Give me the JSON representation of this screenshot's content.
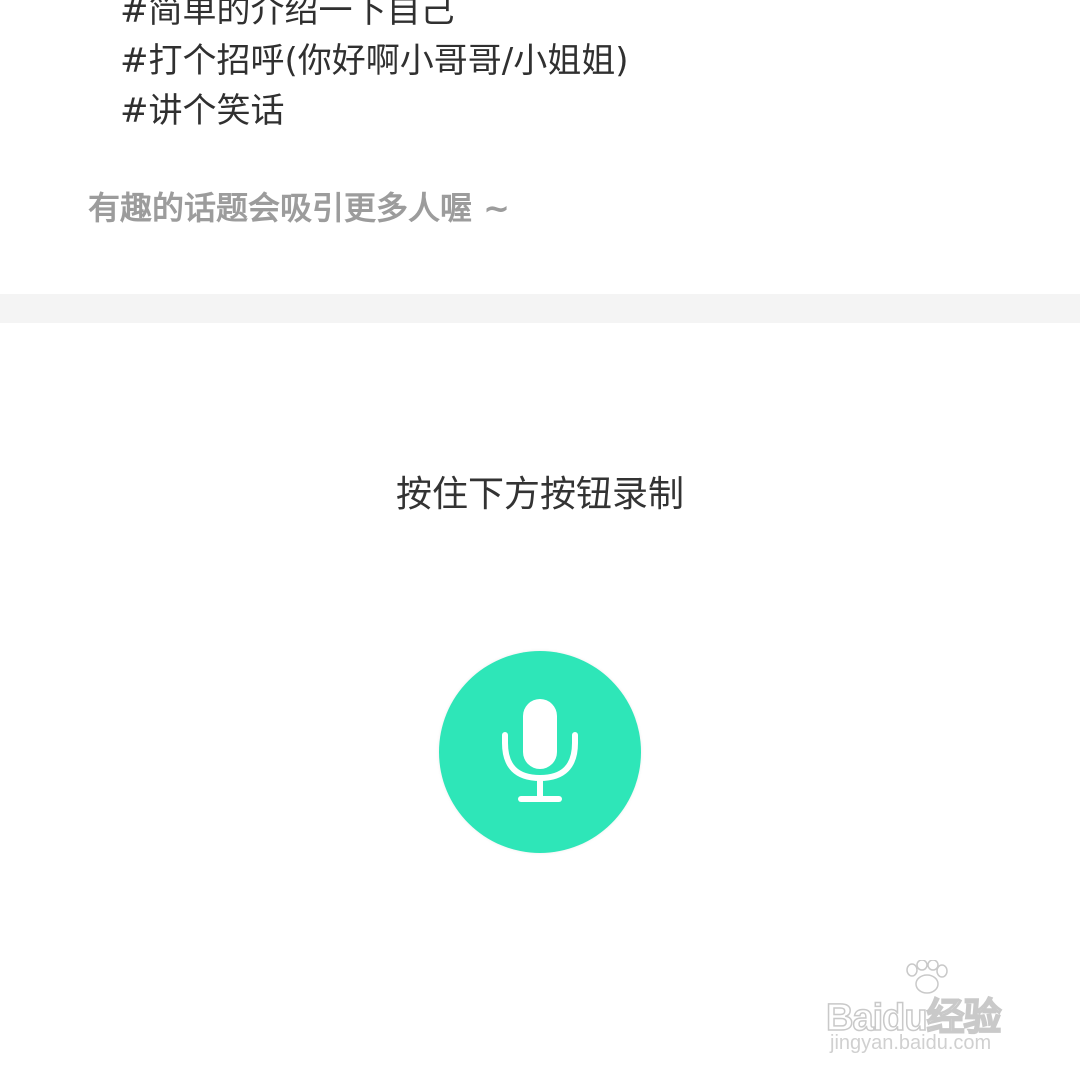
{
  "topics": {
    "items": [
      {
        "text": "#简单的介绍一下自己"
      },
      {
        "text": "#打个招呼(你好啊小哥哥/小姐姐)"
      },
      {
        "text": "#讲个笑话"
      }
    ]
  },
  "hint": {
    "text": "有趣的话题会吸引更多人喔 ~"
  },
  "recorder": {
    "instruction": "按住下方按钮录制",
    "button_icon": "microphone-icon",
    "button_color": "#2ee6b8"
  },
  "watermark": {
    "brand": "Baidu经验",
    "url": "jingyan.baidu.com"
  }
}
